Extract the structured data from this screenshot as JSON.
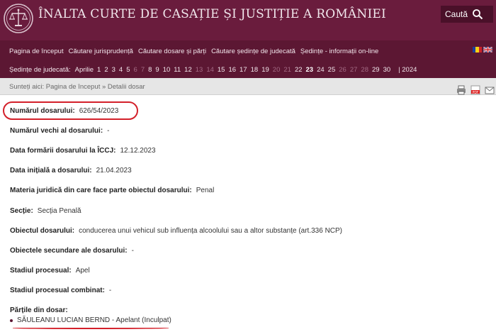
{
  "header": {
    "title": "ÎNALTA CURTE DE CASAȚIE ȘI JUSTIȚIE A ROMÂNIEI",
    "search_label": "Caută",
    "logo_icon": "scales-of-justice-logo"
  },
  "nav": {
    "items": [
      "Pagina de început",
      "Căutare jurisprudență",
      "Căutare dosare și părți",
      "Căutare ședințe de judecată",
      "Ședințe - informații on-line"
    ],
    "flags": [
      "romania-flag-icon",
      "uk-flag-icon"
    ]
  },
  "sessions": {
    "label": "Ședințe de judecată:",
    "month": "Aprilie",
    "days": [
      {
        "d": "1",
        "weekend": false
      },
      {
        "d": "2",
        "weekend": false
      },
      {
        "d": "3",
        "weekend": false
      },
      {
        "d": "4",
        "weekend": false
      },
      {
        "d": "5",
        "weekend": false
      },
      {
        "d": "6",
        "weekend": true
      },
      {
        "d": "7",
        "weekend": true
      },
      {
        "d": "8",
        "weekend": false
      },
      {
        "d": "9",
        "weekend": false
      },
      {
        "d": "10",
        "weekend": false
      },
      {
        "d": "11",
        "weekend": false
      },
      {
        "d": "12",
        "weekend": false
      },
      {
        "d": "13",
        "weekend": true
      },
      {
        "d": "14",
        "weekend": true
      },
      {
        "d": "15",
        "weekend": false
      },
      {
        "d": "16",
        "weekend": false
      },
      {
        "d": "17",
        "weekend": false
      },
      {
        "d": "18",
        "weekend": false
      },
      {
        "d": "19",
        "weekend": false
      },
      {
        "d": "20",
        "weekend": true
      },
      {
        "d": "21",
        "weekend": true
      },
      {
        "d": "22",
        "weekend": false
      },
      {
        "d": "23",
        "weekend": false,
        "current": true
      },
      {
        "d": "24",
        "weekend": false
      },
      {
        "d": "25",
        "weekend": false
      },
      {
        "d": "26",
        "weekend": true
      },
      {
        "d": "27",
        "weekend": true
      },
      {
        "d": "28",
        "weekend": true
      },
      {
        "d": "29",
        "weekend": false
      },
      {
        "d": "30",
        "weekend": false
      }
    ],
    "year": "| 2024"
  },
  "breadcrumb": "Sunteți aici: Pagina de început » Detalii dosar",
  "tools": [
    "print-icon",
    "pdf-icon",
    "email-icon"
  ],
  "details": [
    {
      "label": "Numărul dosarului:",
      "value": "626/54/2023"
    },
    {
      "label": "Numărul vechi al dosarului:",
      "value": "-"
    },
    {
      "label": "Data formării dosarului la ÎCCJ:",
      "value": "12.12.2023"
    },
    {
      "label": "Data inițială a dosarului:",
      "value": "21.04.2023"
    },
    {
      "label": "Materia juridică din care face parte obiectul dosarului:",
      "value": "Penal"
    },
    {
      "label": "Secție:",
      "value": "Secția Penală"
    },
    {
      "label": "Obiectul dosarului:",
      "value": "conducerea unui vehicul sub influența alcoolului sau a altor substanțe (art.336 NCP)"
    },
    {
      "label": "Obiectele secundare ale dosarului:",
      "value": "-"
    },
    {
      "label": "Stadiul procesual:",
      "value": "Apel"
    },
    {
      "label": "Stadiul procesual combinat:",
      "value": "-"
    }
  ],
  "parties": {
    "label": "Părțile din dosar:",
    "items": [
      "SĂULEANU LUCIAN BERND - Apelant (Inculpat)"
    ]
  },
  "colors": {
    "header_bg": "#6a1c3d",
    "nav_bg": "#5c1733",
    "highlight": "#d3202a"
  }
}
